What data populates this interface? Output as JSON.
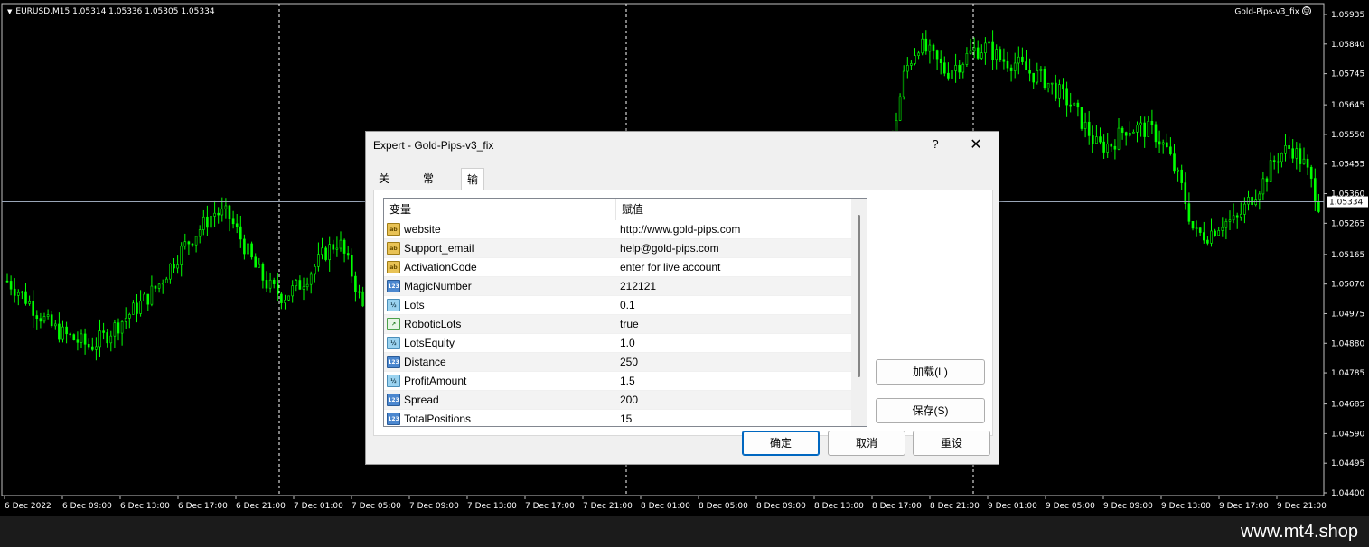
{
  "chart": {
    "symbol_info": "EURUSD,M15  1.05314 1.05336 1.05305 1.05334",
    "ea_name": "Gold-Pips-v3_fix",
    "ea_smile": "☺",
    "current_price": "1.05334",
    "price_axis": [
      "1.05935",
      "1.05840",
      "1.05745",
      "1.05645",
      "1.05550",
      "1.05455",
      "1.05360",
      "1.05265",
      "1.05165",
      "1.05070",
      "1.04975",
      "1.04880",
      "1.04785",
      "1.04685",
      "1.04590",
      "1.04495",
      "1.04400"
    ],
    "time_axis": [
      "6 Dec 2022",
      "6 Dec 09:00",
      "6 Dec 13:00",
      "6 Dec 17:00",
      "6 Dec 21:00",
      "7 Dec 01:00",
      "7 Dec 05:00",
      "7 Dec 09:00",
      "7 Dec 13:00",
      "7 Dec 17:00",
      "7 Dec 21:00",
      "8 Dec 01:00",
      "8 Dec 05:00",
      "8 Dec 09:00",
      "8 Dec 13:00",
      "8 Dec 17:00",
      "8 Dec 21:00",
      "9 Dec 01:00",
      "9 Dec 05:00",
      "9 Dec 09:00",
      "9 Dec 13:00",
      "9 Dec 17:00",
      "9 Dec 21:00"
    ],
    "candle_color": "#00ff00",
    "background": "#000000",
    "price_path": [
      1.0508,
      1.0504,
      1.0499,
      1.0494,
      1.0491,
      1.0489,
      1.0487,
      1.049,
      1.0494,
      1.0498,
      1.0502,
      1.0507,
      1.0514,
      1.052,
      1.0525,
      1.053,
      1.0529,
      1.0521,
      1.0512,
      1.0506,
      1.0503,
      1.0506,
      1.0511,
      1.0517,
      1.0521,
      1.051,
      1.0496,
      1.0484,
      1.0473,
      1.0466,
      1.0463,
      1.0465,
      1.0466,
      1.0465,
      1.0464,
      1.0466,
      1.0465,
      1.0462,
      1.046,
      1.0458,
      1.046,
      1.0465,
      1.047,
      1.0467,
      1.0461,
      1.0458,
      1.0455,
      1.0452,
      1.046,
      1.0471,
      1.0486,
      1.0501,
      1.0512,
      1.0518,
      1.0519,
      1.052,
      1.0522,
      1.0528,
      1.054,
      1.055,
      1.0552,
      1.0549,
      1.0553,
      1.0548,
      1.0551,
      1.0575,
      1.0584,
      1.058,
      1.0575,
      1.0578,
      1.0582,
      1.0583,
      1.0579,
      1.0578,
      1.0575,
      1.0573,
      1.0569,
      1.0565,
      1.0558,
      1.0551,
      1.0552,
      1.0557,
      1.0557,
      1.0556,
      1.055,
      1.0539,
      1.0523,
      1.0523,
      1.0527,
      1.0527,
      1.0534,
      1.054,
      1.0548,
      1.0551,
      1.0545,
      1.0533
    ]
  },
  "dialog": {
    "title": "Expert - Gold-Pips-v3_fix",
    "help": "?",
    "close": "✕",
    "tabs": {
      "about": "关于",
      "common": "常用",
      "inputs": "输入参数"
    },
    "table": {
      "col_variable": "变量",
      "col_value": "赋值"
    },
    "params": [
      {
        "icon": "ab",
        "type": "str",
        "name": "website",
        "value": "http://www.gold-pips.com"
      },
      {
        "icon": "ab",
        "type": "str",
        "name": "Support_email",
        "value": "help@gold-pips.com"
      },
      {
        "icon": "ab",
        "type": "str",
        "name": "ActivationCode",
        "value": "enter for live account"
      },
      {
        "icon": "123",
        "type": "int",
        "name": "MagicNumber",
        "value": "212121"
      },
      {
        "icon": "½",
        "type": "dbl",
        "name": "Lots",
        "value": "0.1"
      },
      {
        "icon": "↗",
        "type": "bool",
        "name": "RoboticLots",
        "value": "true"
      },
      {
        "icon": "½",
        "type": "dbl",
        "name": "LotsEquity",
        "value": "1.0"
      },
      {
        "icon": "123",
        "type": "int",
        "name": "Distance",
        "value": "250"
      },
      {
        "icon": "½",
        "type": "dbl",
        "name": "ProfitAmount",
        "value": "1.5"
      },
      {
        "icon": "123",
        "type": "int",
        "name": "Spread",
        "value": "200"
      },
      {
        "icon": "123",
        "type": "int",
        "name": "TotalPositions",
        "value": "15"
      }
    ],
    "buttons": {
      "load": "加载(L)",
      "save": "保存(S)",
      "ok": "确定",
      "cancel": "取消",
      "reset": "重设"
    }
  },
  "footer": {
    "watermark": "www.mt4.shop"
  }
}
